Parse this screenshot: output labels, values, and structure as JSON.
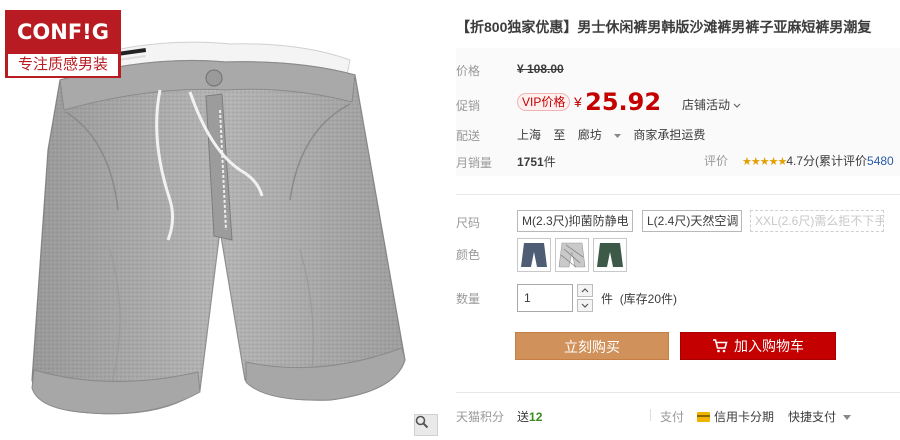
{
  "brand": {
    "name": "CONF!G",
    "slogan": "专注质感男装"
  },
  "product": {
    "title": "【折800独家优惠】男士休闲裤男韩版沙滩裤男裤子亚麻短裤男潮复"
  },
  "price": {
    "label": "价格",
    "original": "¥ 108.00",
    "promo_label": "促销",
    "vip_tag": "VIP价格",
    "currency": "¥",
    "promo_value": "25.92",
    "shop_activity": "店铺活动"
  },
  "shipping": {
    "label": "配送",
    "from": "上海",
    "to_word": "至",
    "dest": "廊坊",
    "note": "商家承担运费"
  },
  "sales": {
    "label": "月销量",
    "count": "1751",
    "unit": "件",
    "rating_label": "评价",
    "stars": "★★★★★",
    "score": "4.7分",
    "reviews_prefix": "(累计评价",
    "reviews_count": "5480"
  },
  "size": {
    "label": "尺码",
    "options": [
      {
        "text": "M(2.3尺)抑菌防静电",
        "enabled": true
      },
      {
        "text": "L(2.4尺)天然空调",
        "enabled": true
      },
      {
        "text": "XXL(2.6尺)需么拒不下手",
        "enabled": false
      }
    ]
  },
  "color": {
    "label": "颜色",
    "swatches": [
      {
        "name": "深蓝",
        "hex": "#4f5d74"
      },
      {
        "name": "浅灰",
        "hex": "#c9c9c9"
      },
      {
        "name": "墨绿",
        "hex": "#3d5a48"
      }
    ]
  },
  "quantity": {
    "label": "数量",
    "value": "1",
    "unit": "件",
    "stock": "(库存20件)"
  },
  "actions": {
    "buy_now": "立刻购买",
    "add_to_cart": "加入购物车"
  },
  "bottom": {
    "points_label": "天猫积分",
    "points_prefix": "送",
    "points_value": "12",
    "pay_label": "支付",
    "credit": "信用卡分期",
    "quick_pay": "快捷支付"
  },
  "colors": {
    "accent_red": "#c40000",
    "buy_orange": "#d0915a",
    "brand_red": "#b81c22"
  }
}
